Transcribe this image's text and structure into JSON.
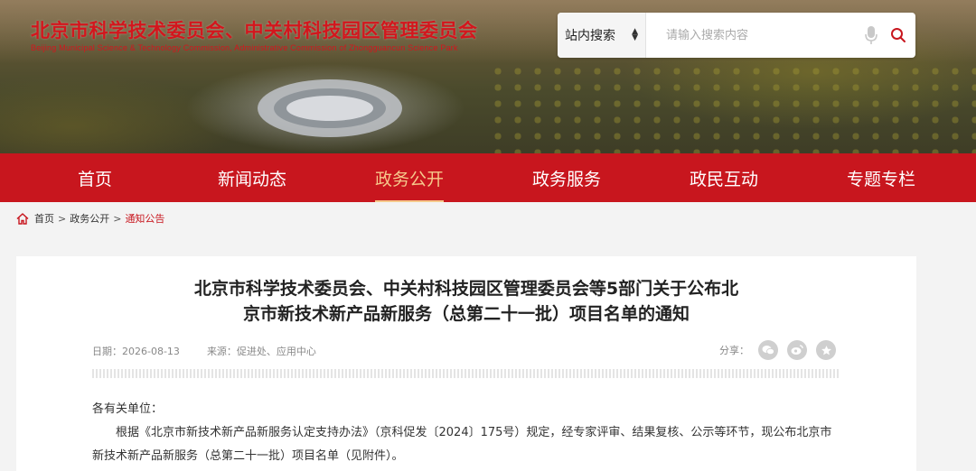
{
  "header": {
    "title": "北京市科学技术委员会、中关村科技园区管理委员会",
    "subtitle": "Beijing Municipal Science & Technology Commission, Administrative Commission of Zhongguancun Science Park"
  },
  "search": {
    "scope": "站内搜索",
    "placeholder": "请输入搜索内容",
    "icons": [
      "microphone-icon",
      "search-icon"
    ]
  },
  "nav": {
    "items": [
      {
        "label": "首页",
        "active": false
      },
      {
        "label": "新闻动态",
        "active": false
      },
      {
        "label": "政务公开",
        "active": true
      },
      {
        "label": "政务服务",
        "active": false
      },
      {
        "label": "政民互动",
        "active": false
      },
      {
        "label": "专题专栏",
        "active": false
      }
    ]
  },
  "breadcrumb": {
    "home": "首页",
    "level2": "政务公开",
    "current": "通知公告",
    "separator": ">"
  },
  "article": {
    "title_line1": "北京市科学技术委员会、中关村科技园区管理委员会等5部门关于公布北",
    "title_line2": "京市新技术新产品新服务（总第二十一批）项目名单的通知",
    "date": "日期：2026-08-13",
    "source": "来源：促进处、应用中心",
    "share_label": "分享：",
    "greeting": "各有关单位：",
    "paragraph": "根据《北京市新技术新产品新服务认定支持办法》（京科促发〔2024〕175号）规定，经专家评审、结果复核、公示等环节，现公布北京市新技术新产品新服务（总第二十一批）项目名单（见附件）。"
  },
  "colors": {
    "brand_red": "#c8161e",
    "active_gold": "#f6c98c"
  }
}
